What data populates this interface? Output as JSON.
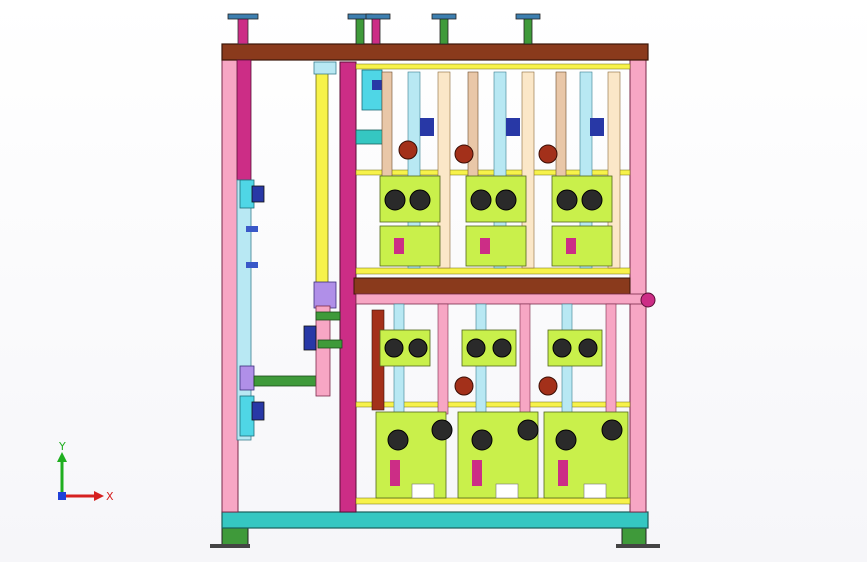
{
  "viewport": {
    "background_color": "#f4f4f7"
  },
  "model_colors": {
    "frame_pink": "#f7a6c4",
    "frame_magenta": "#cc2d86",
    "top_beam": "#8a3a1c",
    "base_beam": "#35c7c2",
    "pipe_yellow": "#f7f24a",
    "pipe_green": "#3f9a3a",
    "pipe_cyan": "#4fd6e6",
    "valve_blue": "#2838a6",
    "gauge_red": "#a3301a",
    "pump_lime": "#c9f04b"
  },
  "triad": {
    "x_label": "X",
    "y_label": "Y",
    "x_color": "#d62020",
    "y_color": "#1fae1f",
    "z_color": "#2040d8"
  }
}
